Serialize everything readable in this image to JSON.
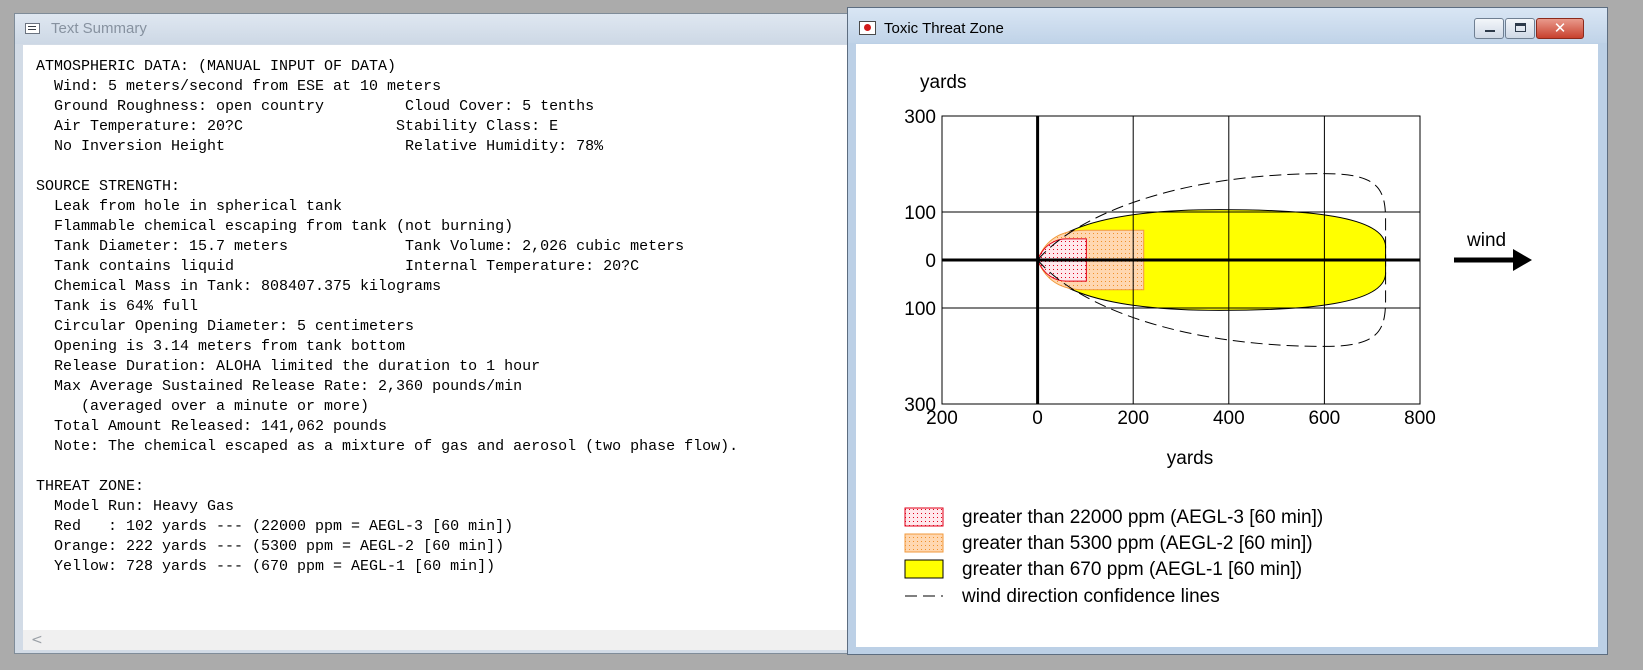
{
  "text_summary": {
    "title": "Text Summary",
    "lines": [
      "ATMOSPHERIC DATA: (MANUAL INPUT OF DATA)",
      "  Wind: 5 meters/second from ESE at 10 meters",
      "  Ground Roughness: open country         Cloud Cover: 5 tenths",
      "  Air Temperature: 20?C                 Stability Class: E",
      "  No Inversion Height                    Relative Humidity: 78%",
      "",
      "SOURCE STRENGTH:",
      "  Leak from hole in spherical tank",
      "  Flammable chemical escaping from tank (not burning)",
      "  Tank Diameter: 15.7 meters             Tank Volume: 2,026 cubic meters",
      "  Tank contains liquid                   Internal Temperature: 20?C",
      "  Chemical Mass in Tank: 808407.375 kilograms",
      "  Tank is 64% full",
      "  Circular Opening Diameter: 5 centimeters",
      "  Opening is 3.14 meters from tank bottom",
      "  Release Duration: ALOHA limited the duration to 1 hour",
      "  Max Average Sustained Release Rate: 2,360 pounds/min",
      "     (averaged over a minute or more)",
      "  Total Amount Released: 141,062 pounds",
      "  Note: The chemical escaped as a mixture of gas and aerosol (two phase flow).",
      "",
      "THREAT ZONE:",
      "  Model Run: Heavy Gas",
      "  Red   : 102 yards --- (22000 ppm = AEGL-3 [60 min])",
      "  Orange: 222 yards --- (5300 ppm = AEGL-2 [60 min])",
      "  Yellow: 728 yards --- (670 ppm = AEGL-1 [60 min])"
    ],
    "scroll_left_glyph": "<"
  },
  "threat_zone_window": {
    "title": "Toxic Threat Zone",
    "close_glyph": "✕",
    "wind_label": "wind"
  },
  "chart_data": {
    "type": "area",
    "xlabel": "yards",
    "ylabel": "yards",
    "x_ticks": [
      "200",
      "0",
      "200",
      "400",
      "600",
      "800"
    ],
    "y_ticks": [
      "300",
      "100",
      "0",
      "100",
      "300"
    ],
    "xlim": [
      -200,
      800
    ],
    "ylim": [
      -300,
      300
    ],
    "grid": true,
    "colors": {
      "red": "#e0001a",
      "orange": "#f29a3c",
      "yellow": "#ffff00",
      "red_fill": "#ffe5ea",
      "orange_fill": "#ffd9b5"
    },
    "zones": [
      {
        "name": "red",
        "max_x": 102,
        "half_width": 44,
        "legend": "greater than 22000 ppm (AEGL-3 [60 min])"
      },
      {
        "name": "orange",
        "max_x": 222,
        "half_width": 62,
        "legend": "greater than 5300 ppm (AEGL-2 [60 min])"
      },
      {
        "name": "yellow",
        "max_x": 728,
        "half_width": 105,
        "legend": "greater than 670 ppm (AEGL-1 [60 min])"
      }
    ],
    "confidence_legend": "wind direction confidence lines",
    "confidence_extent_x": 728,
    "confidence_half_width": 180
  }
}
